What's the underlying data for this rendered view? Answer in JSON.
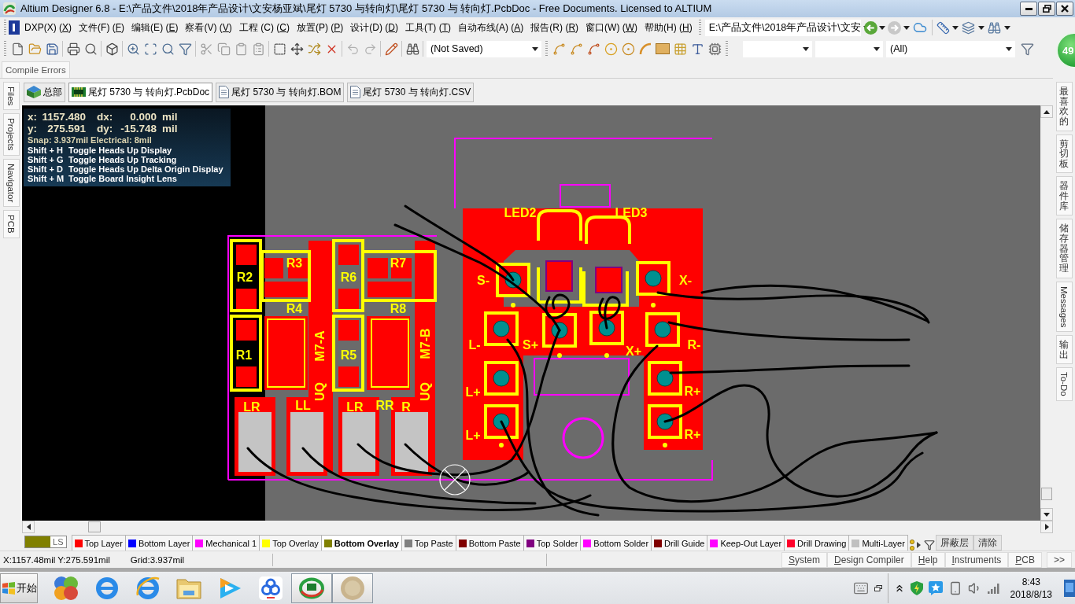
{
  "window": {
    "title": "Altium Designer 6.8 - E:\\产品文件\\2018年产品设计\\文安杨亚斌\\尾灯 5730 与转向灯\\尾灯 5730 与 转向灯.PcbDoc - Free Documents. Licensed to ALTIUM"
  },
  "menu": [
    {
      "label": "DXP(X) (X)"
    },
    {
      "label": "文件(F) (F)"
    },
    {
      "label": "编辑(E) (E)"
    },
    {
      "label": "察看(V) (V)"
    },
    {
      "label": "工程 (C) (C)"
    },
    {
      "label": "放置(P) (P)"
    },
    {
      "label": "设计(D) (D)"
    },
    {
      "label": "工具(T) (T)"
    },
    {
      "label": "自动布线(A) (A)"
    },
    {
      "label": "报告(R) (R)"
    },
    {
      "label": "窗口(W) (W)"
    },
    {
      "label": "帮助(H) (H)"
    }
  ],
  "path_combo": {
    "value": "E:\\产品文件\\2018年产品设计\\文安"
  },
  "toolbar": {
    "document_state": "(Not Saved)",
    "filter_value": "(All)"
  },
  "compile_errors_tab": {
    "label": "Compile Errors"
  },
  "left_panel_tabs": [
    {
      "label": "Files"
    },
    {
      "label": "Projects"
    },
    {
      "label": "Navigator"
    },
    {
      "label": "PCB"
    }
  ],
  "document_tabs": [
    {
      "label": "总部",
      "kind": "project",
      "selected": false
    },
    {
      "label": "尾灯 5730 与 转向灯.PcbDoc",
      "kind": "pcb",
      "selected": true
    },
    {
      "label": "尾灯 5730 与 转向灯.BOM",
      "kind": "text",
      "selected": false
    },
    {
      "label": "尾灯 5730 与 转向灯.CSV",
      "kind": "text",
      "selected": false
    }
  ],
  "heads_up_display": {
    "rows": [
      {
        "axis": "x:",
        "value": "1157.480",
        "delta_label": "dx:",
        "delta": "0.000",
        "unit": "mil"
      },
      {
        "axis": "y:",
        "value": "275.591",
        "delta_label": "dy:",
        "delta": "-15.748",
        "unit": "mil"
      }
    ],
    "snap": "Snap: 3.937mil Electrical: 8mil",
    "shortcuts": [
      {
        "keys": "Shift + H",
        "action": "Toggle Heads Up Display"
      },
      {
        "keys": "Shift + G",
        "action": "Toggle Heads Up Tracking"
      },
      {
        "keys": "Shift + D",
        "action": "Toggle Heads Up Delta Origin Display"
      },
      {
        "keys": "Shift + M",
        "action": "Toggle Board Insight Lens"
      }
    ]
  },
  "pcb": {
    "designators": [
      "LED2",
      "LED3",
      "R2",
      "R3",
      "R6",
      "R7",
      "R4",
      "R8",
      "R1",
      "R5",
      "M7-A",
      "M7-B",
      "LR",
      "LL",
      "UQ",
      "LR",
      "RR",
      "R",
      "UQ"
    ],
    "pad_labels": [
      "S-",
      "X-",
      "L-",
      "S+",
      "X+",
      "R-",
      "L+",
      "R+",
      "L+",
      "R+"
    ]
  },
  "right_panel_tabs": [
    {
      "label": "最喜欢的",
      "kind": "stacked"
    },
    {
      "label": "剪切板",
      "kind": "stacked"
    },
    {
      "label": "器件库",
      "kind": "stacked"
    },
    {
      "label": "储存器管理",
      "kind": "stacked"
    },
    {
      "label": "Messages",
      "kind": "rotated"
    },
    {
      "label": "输出",
      "kind": "stacked"
    },
    {
      "label": "To-Do",
      "kind": "rotated"
    }
  ],
  "layer_bar": {
    "current_layer": {
      "label": "LS",
      "color": "#808000"
    },
    "layers": [
      {
        "name": "Top Layer",
        "color": "#ff0000",
        "selected": false
      },
      {
        "name": "Bottom Layer",
        "color": "#0000ff",
        "selected": false
      },
      {
        "name": "Mechanical 1",
        "color": "#ff00ff",
        "selected": false
      },
      {
        "name": "Top Overlay",
        "color": "#ffff00",
        "selected": false
      },
      {
        "name": "Bottom Overlay",
        "color": "#808000",
        "selected": true
      },
      {
        "name": "Top Paste",
        "color": "#808080",
        "selected": false
      },
      {
        "name": "Bottom Paste",
        "color": "#800000",
        "selected": false
      },
      {
        "name": "Top Solder",
        "color": "#800080",
        "selected": false
      },
      {
        "name": "Bottom Solder",
        "color": "#ff00ff",
        "selected": false
      },
      {
        "name": "Drill Guide",
        "color": "#800000",
        "selected": false
      },
      {
        "name": "Keep-Out Layer",
        "color": "#ff00ff",
        "selected": false
      },
      {
        "name": "Drill Drawing",
        "color": "#ff002a",
        "selected": false
      },
      {
        "name": "Multi-Layer",
        "color": "#c0c0c0",
        "selected": false
      }
    ],
    "buttons": [
      {
        "label": "屏蔽层"
      },
      {
        "label": "清除"
      }
    ]
  },
  "status_bar": {
    "coordinates": "X:1157.48mil Y:275.591mil",
    "grid": "Grid:3.937mil",
    "panels": [
      {
        "label": "System"
      },
      {
        "label": "Design Compiler"
      },
      {
        "label": "Help"
      },
      {
        "label": "Instruments"
      },
      {
        "label": "PCB"
      }
    ],
    "more": ">>"
  },
  "taskbar": {
    "start": "开始",
    "apps": [
      {
        "open": false
      },
      {
        "open": false
      },
      {
        "open": false
      },
      {
        "open": false
      },
      {
        "open": false
      },
      {
        "open": false
      },
      {
        "open": true
      },
      {
        "open": true
      }
    ],
    "time": "8:43",
    "date": "2018/8/13"
  },
  "floating_ball": {
    "value": "49"
  }
}
